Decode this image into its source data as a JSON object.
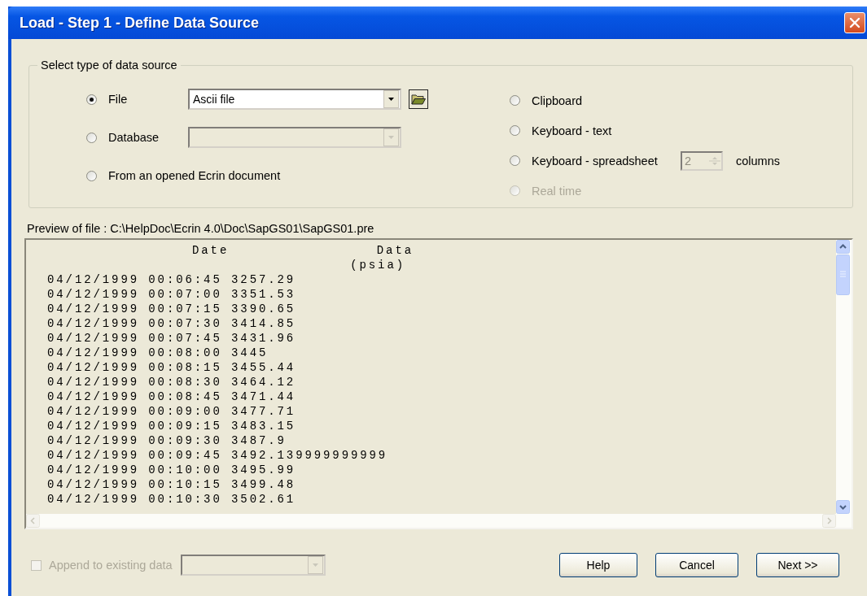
{
  "window": {
    "title": "Load - Step 1 - Define Data Source"
  },
  "source_group": {
    "label": "Select type of data source",
    "left_options": [
      {
        "kind": "combo",
        "label": "File",
        "selected": true,
        "disabled": false,
        "combo_value": "Ascii file",
        "combo_disabled": false,
        "browse_button": true
      },
      {
        "kind": "combo",
        "label": "Database",
        "selected": false,
        "disabled": false,
        "combo_disabled": true
      },
      {
        "kind": "plain",
        "label": "From an opened Ecrin document",
        "selected": false,
        "disabled": false
      }
    ],
    "right_options": [
      {
        "kind": "plain",
        "label": "Clipboard",
        "selected": false,
        "disabled": false
      },
      {
        "kind": "plain",
        "label": "Keyboard - text",
        "selected": false,
        "disabled": false
      },
      {
        "kind": "spin",
        "label": "Keyboard - spreadsheet",
        "selected": false,
        "disabled": false,
        "spin_value": "2",
        "spin_disabled": true,
        "unit": "columns"
      },
      {
        "kind": "plain",
        "label": "Real time",
        "selected": false,
        "disabled": true
      }
    ]
  },
  "preview": {
    "label": "Preview of file : C:\\HelpDoc\\Ecrin 4.0\\Doc\\SapGS01\\SapGS01.pre",
    "headers": [
      {
        "name": "Date"
      },
      {
        "name": "Data",
        "unit": "(psia)"
      }
    ],
    "lines": [
      "04/12/1999 00:06:45 3257.29",
      "04/12/1999 00:07:00 3351.53",
      "04/12/1999 00:07:15 3390.65",
      "04/12/1999 00:07:30 3414.85",
      "04/12/1999 00:07:45 3431.96",
      "04/12/1999 00:08:00 3445",
      "04/12/1999 00:08:15 3455.44",
      "04/12/1999 00:08:30 3464.12",
      "04/12/1999 00:08:45 3471.44",
      "04/12/1999 00:09:00 3477.71",
      "04/12/1999 00:09:15 3483.15",
      "04/12/1999 00:09:30 3487.9",
      "04/12/1999 00:09:45 3492.139999999999",
      "04/12/1999 00:10:00 3495.99",
      "04/12/1999 00:10:15 3499.48",
      "04/12/1999 00:10:30 3502.61"
    ]
  },
  "append": {
    "label": "Append to existing data",
    "checked": false,
    "disabled": true,
    "combo_disabled": true
  },
  "buttons": [
    "Help",
    "Cancel",
    "Next >>"
  ]
}
